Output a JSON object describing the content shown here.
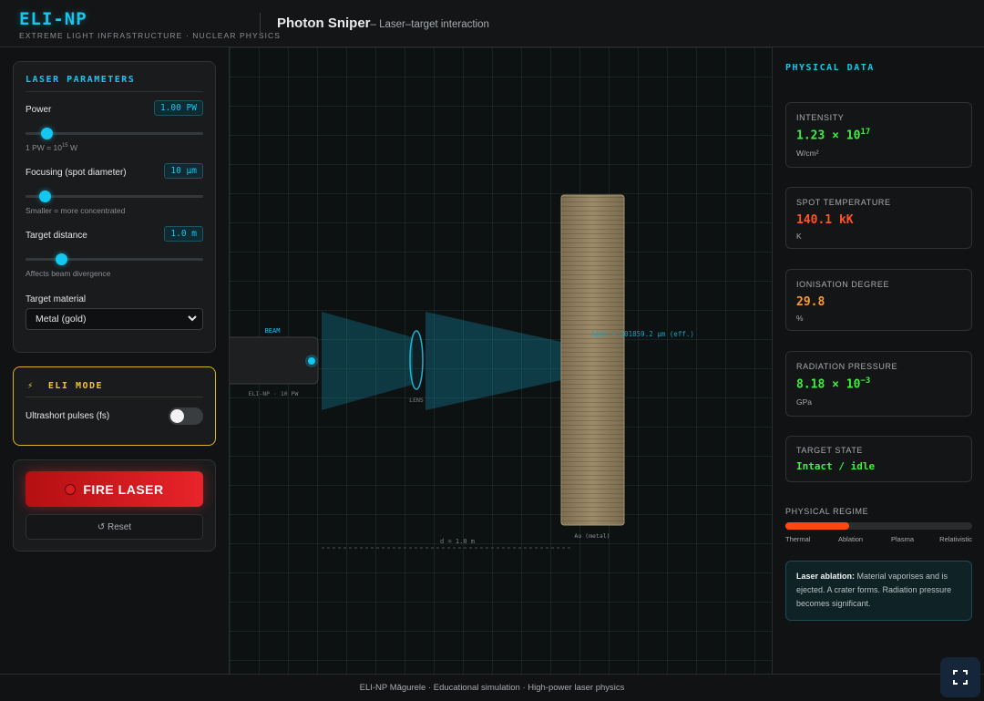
{
  "header": {
    "brand": "ELI-NP",
    "brand_sub": "EXTREME LIGHT INFRASTRUCTURE · NUCLEAR PHYSICS",
    "title": "Photon Sniper",
    "subtitle": "– Laser–target interaction"
  },
  "laser_params": {
    "title": "LASER PARAMETERS",
    "power": {
      "label": "Power",
      "value": "1.00 PW",
      "hint_pre": "1 PW = 10",
      "hint_exp": "15",
      "hint_post": " W",
      "fraction": 0.12
    },
    "focusing": {
      "label": "Focusing (spot diameter)",
      "value": "10 µm",
      "hint": "Smaller = more concentrated",
      "fraction": 0.11
    },
    "distance": {
      "label": "Target distance",
      "value": "1.0 m",
      "hint": "Affects beam divergence",
      "fraction": 0.2
    },
    "material": {
      "label": "Target material",
      "selected": "Metal (gold)"
    }
  },
  "eli_mode": {
    "title": "ELI MODE",
    "ultrashort_label": "Ultrashort pulses (fs)",
    "enabled": false
  },
  "actions": {
    "fire_label": "FIRE LASER",
    "reset_label": "↺ Reset"
  },
  "stage": {
    "beam_label": "BEAM",
    "laser_label": "ELI-NP · 10 PW",
    "lens_label": "LENS",
    "spot_label": "Spot ≈ 101859.2 µm (eff.)",
    "target_label": "Au (metal)",
    "distance_label": "d = 1.0 m"
  },
  "physical_data": {
    "title": "PHYSICAL DATA",
    "intensity": {
      "label": "INTENSITY",
      "mantissa": "1.23 × 10",
      "exp": "17",
      "unit": "W/cm²"
    },
    "temperature": {
      "label": "SPOT TEMPERATURE",
      "value": "140.1 kK",
      "unit": "K"
    },
    "ionisation": {
      "label": "IONISATION DEGREE",
      "value": "29.8",
      "unit": "%"
    },
    "pressure": {
      "label": "RADIATION PRESSURE",
      "mantissa": "8.18 × 10",
      "exp": "−3",
      "unit": "GPa"
    },
    "state": {
      "label": "TARGET STATE",
      "value": "Intact / idle"
    },
    "regime": {
      "label": "PHYSICAL REGIME",
      "fraction": 0.34,
      "ticks": [
        "Thermal",
        "Ablation",
        "Plasma",
        "Relativistic"
      ]
    },
    "info": {
      "heading": "Laser ablation:",
      "text": " Material vaporises and is ejected. A crater forms. Radiation pressure becomes significant."
    }
  },
  "footer": {
    "text": "ELI-NP Măgurele · Educational simulation · High-power laser physics"
  },
  "colors": {
    "accent": "#12c8f0",
    "eli_gold": "#f0c630",
    "fire_red": "#e8242a",
    "value_green": "#3ef040",
    "value_red": "#ff5522",
    "value_orange": "#ff9a33"
  }
}
